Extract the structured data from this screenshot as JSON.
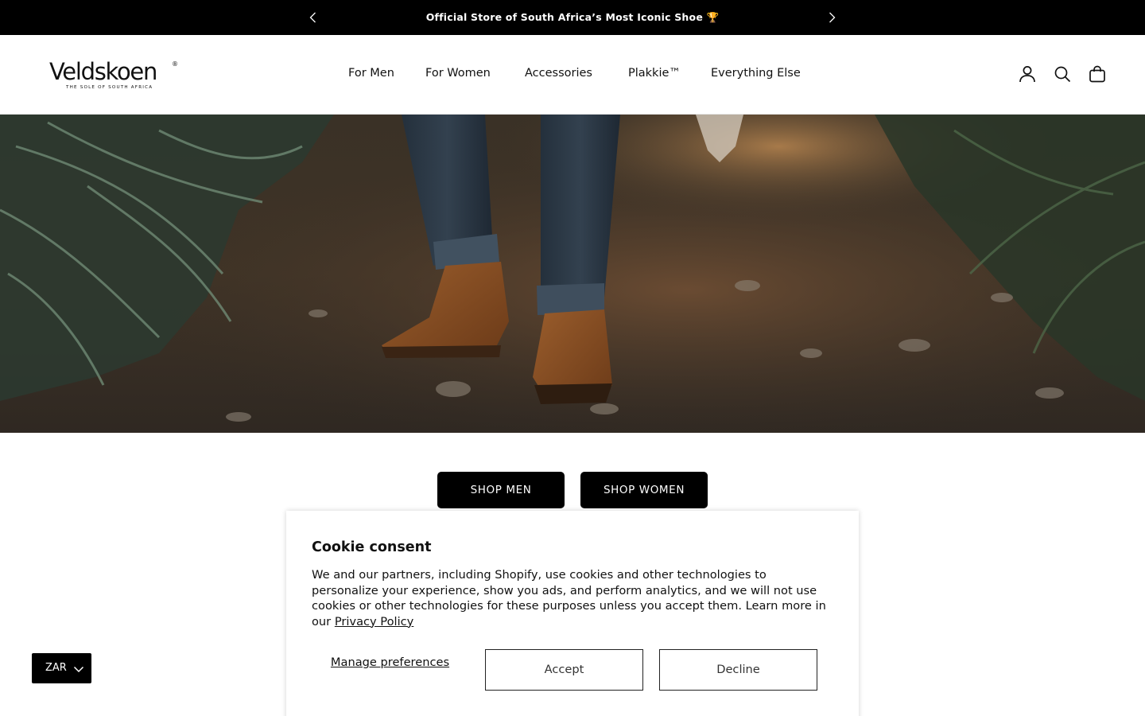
{
  "announcement": {
    "message": "Official Store of South Africa’s Most Iconic Shoe 🏆",
    "prev_icon": "chevron-left-icon",
    "next_icon": "chevron-right-icon"
  },
  "header": {
    "logo": {
      "wordmark": "Veldskoen",
      "registered": "®",
      "tagline": "THE SOLE OF SOUTH AFRICA"
    },
    "nav": [
      {
        "label": "For Men"
      },
      {
        "label": "For Women"
      },
      {
        "label": "Accessories"
      },
      {
        "label": "Plakkie™"
      },
      {
        "label": "Everything Else"
      }
    ],
    "icons": [
      "account-icon",
      "search-icon",
      "cart-bag-icon"
    ]
  },
  "hero": {
    "image": "person-walking-on-forest-path-in-brown-suede-boots"
  },
  "shop_buttons": {
    "men": "SHOP MEN",
    "women": "SHOP WOMEN"
  },
  "currency": {
    "code": "ZAR",
    "icon": "chevron-down-icon"
  },
  "cookie": {
    "title": "Cookie consent",
    "body": "We and our partners, including Shopify, use cookies and other technologies to personalize your experience, show you ads, and perform analytics, and we will not use cookies or other technologies for these purposes unless you accept them. Learn more in our ",
    "link": "Privacy Policy",
    "manage": "Manage preferences",
    "accept": "Accept",
    "decline": "Decline"
  },
  "colors": {
    "bar_background": "#000000",
    "button_background": "#000000",
    "page_background": "#ffffff"
  }
}
